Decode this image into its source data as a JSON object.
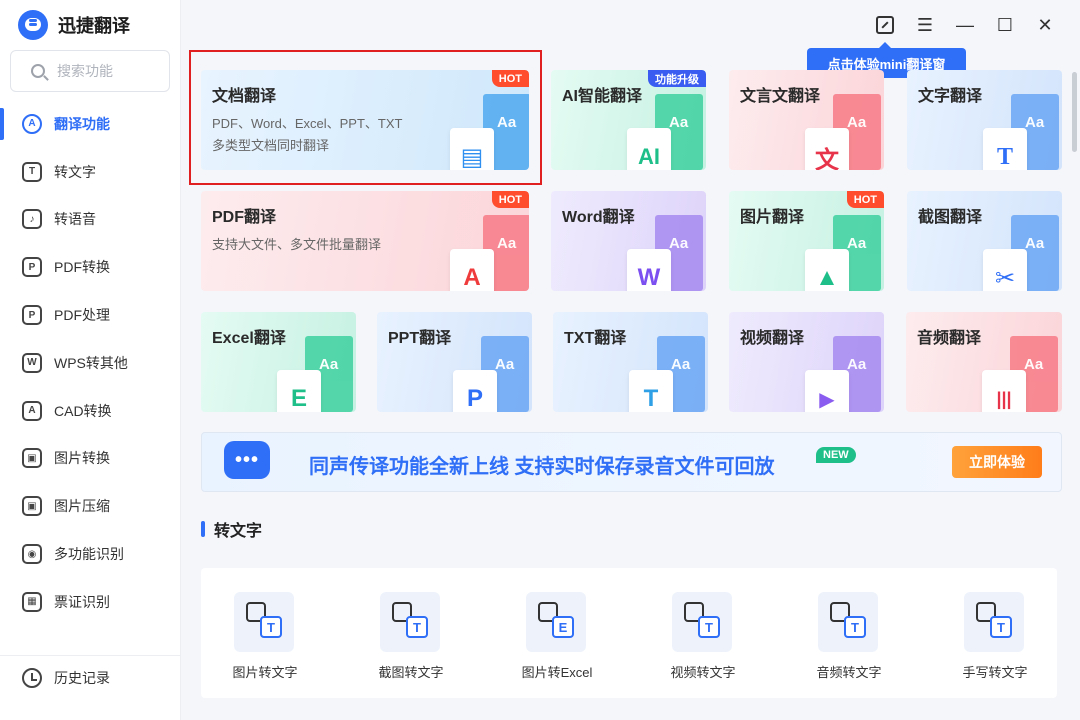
{
  "app": {
    "title": "迅捷翻译"
  },
  "search": {
    "placeholder": "搜索功能"
  },
  "sidebar": {
    "items": [
      {
        "label": "翻译功能",
        "icon": "translate-icon",
        "glyph": "A"
      },
      {
        "label": "转文字",
        "icon": "text-icon",
        "glyph": "T"
      },
      {
        "label": "转语音",
        "icon": "voice-icon",
        "glyph": "♪"
      },
      {
        "label": "PDF转换",
        "icon": "pdf-convert-icon",
        "glyph": "P"
      },
      {
        "label": "PDF处理",
        "icon": "pdf-process-icon",
        "glyph": "P"
      },
      {
        "label": "WPS转其他",
        "icon": "wps-icon",
        "glyph": "W"
      },
      {
        "label": "CAD转换",
        "icon": "cad-icon",
        "glyph": "A"
      },
      {
        "label": "图片转换",
        "icon": "image-convert-icon",
        "glyph": "▣"
      },
      {
        "label": "图片压缩",
        "icon": "image-compress-icon",
        "glyph": "▣"
      },
      {
        "label": "多功能识别",
        "icon": "eye-icon",
        "glyph": "◉"
      },
      {
        "label": "票证识别",
        "icon": "ticket-icon",
        "glyph": "▦"
      }
    ],
    "history": "历史记录"
  },
  "titlebar": {
    "tooltip": "点击体验mini翻译窗",
    "menu_glyph": "☰",
    "min_glyph": "—",
    "max_glyph": "☐",
    "close_glyph": "✕"
  },
  "cards": {
    "doc": {
      "title": "文档翻译",
      "line1": "PDF、Word、Excel、PPT、TXT",
      "line2": "多类型文档同时翻译",
      "badge": "HOT",
      "glyph": "▤"
    },
    "ai": {
      "title": "AI智能翻译",
      "badge": "功能升级",
      "glyph": "AI"
    },
    "classical": {
      "title": "文言文翻译",
      "glyph": "文"
    },
    "text": {
      "title": "文字翻译",
      "glyph": "T"
    },
    "pdf": {
      "title": "PDF翻译",
      "line1": "支持大文件、多文件批量翻译",
      "badge": "HOT",
      "glyph": "A"
    },
    "word": {
      "title": "Word翻译",
      "glyph": "W"
    },
    "image": {
      "title": "图片翻译",
      "badge": "HOT",
      "glyph": "▲"
    },
    "screenshot": {
      "title": "截图翻译",
      "glyph": "✂"
    },
    "excel": {
      "title": "Excel翻译",
      "glyph": "E"
    },
    "ppt": {
      "title": "PPT翻译",
      "glyph": "P"
    },
    "txt": {
      "title": "TXT翻译",
      "glyph": "T"
    },
    "video": {
      "title": "视频翻译",
      "glyph": "▶"
    },
    "audio": {
      "title": "音频翻译",
      "glyph": "|||"
    },
    "doc_back": "Aa"
  },
  "banner": {
    "icon_glyph": "•••",
    "text": "同声传译功能全新上线 支持实时保存录音文件可回放",
    "new": "NEW",
    "button": "立即体验"
  },
  "section": {
    "title": "转文字"
  },
  "tools": [
    {
      "label": "图片转文字",
      "mark": "T"
    },
    {
      "label": "截图转文字",
      "mark": "T"
    },
    {
      "label": "图片转Excel",
      "mark": "E"
    },
    {
      "label": "视频转文字",
      "mark": "T"
    },
    {
      "label": "音频转文字",
      "mark": "T"
    },
    {
      "label": "手写转文字",
      "mark": "T"
    }
  ],
  "colors": {
    "accent": "#2f6ef6",
    "hot": "#ff4d2e",
    "highlight": "#e02020"
  }
}
